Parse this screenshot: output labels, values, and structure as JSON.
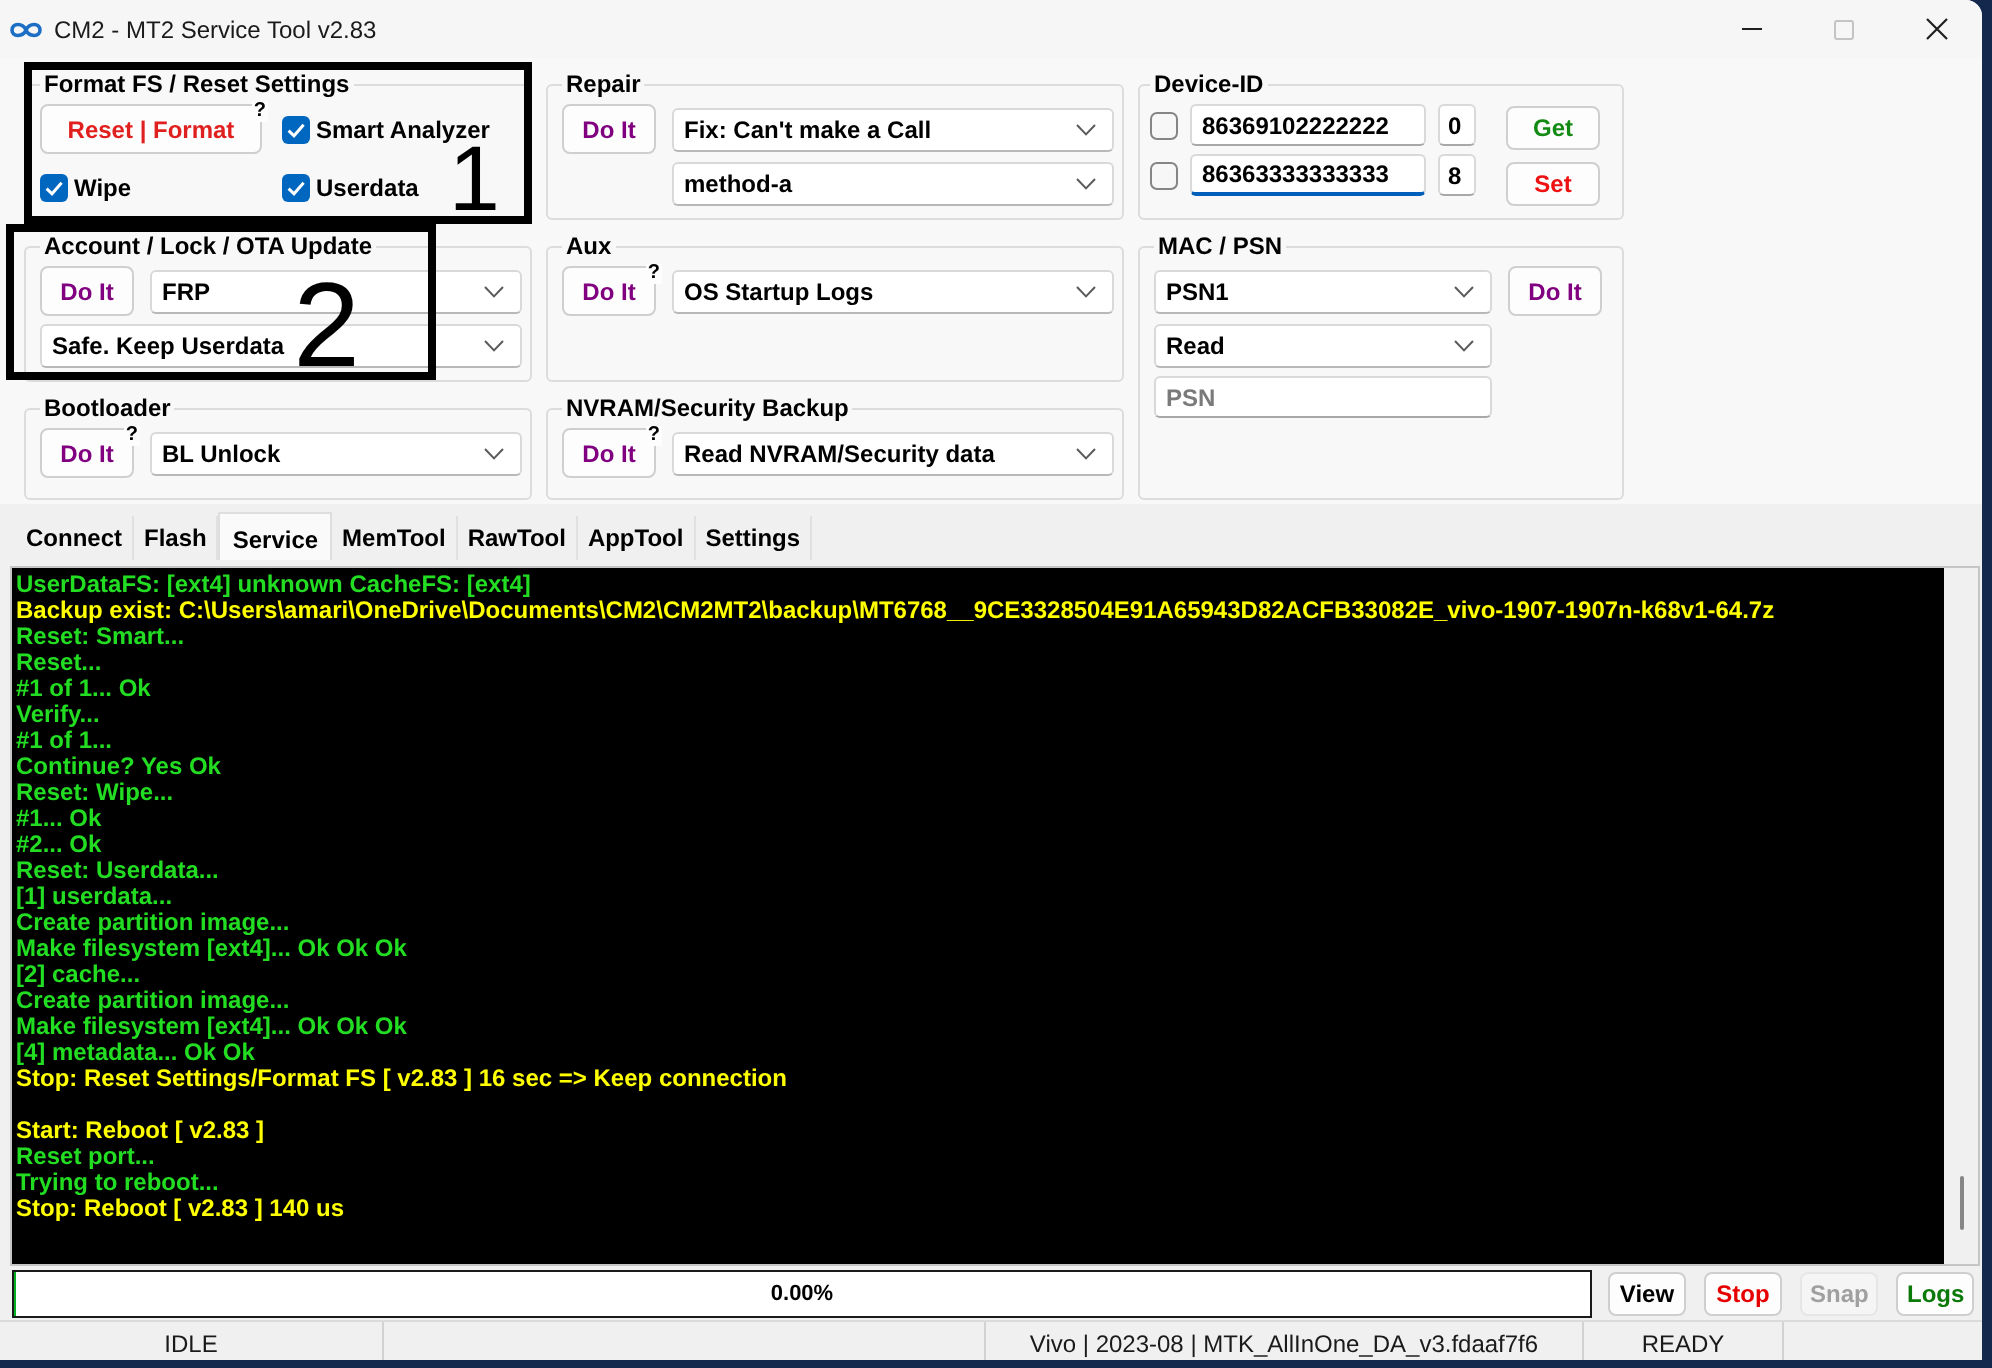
{
  "window": {
    "title": "CM2 - MT2 Service Tool v2.83",
    "controls": [
      {
        "kind": "minimize",
        "disabled": false
      },
      {
        "kind": "maximize",
        "disabled": true
      },
      {
        "kind": "close",
        "disabled": false
      }
    ]
  },
  "groups": [
    {
      "kind": "reset",
      "title": "Format FS / Reset Settings",
      "button": {
        "label": "Reset | Format",
        "help": "?"
      },
      "checkboxes": [
        {
          "label": "Smart Analyzer",
          "checked": true
        },
        {
          "label": "Wipe",
          "checked": true
        },
        {
          "label": "Userdata",
          "checked": true
        }
      ],
      "annotation": {
        "label": "1"
      }
    },
    {
      "kind": "action",
      "title": "Repair",
      "button": {
        "label": "Do It"
      },
      "selects": [
        "Fix: Can't make a Call",
        "method-a"
      ]
    },
    {
      "kind": "device_id",
      "title": "Device-ID",
      "ids": [
        {
          "checked": false,
          "value": "86369102222222",
          "slot": "0",
          "focused": false
        },
        {
          "checked": false,
          "value": "86363333333333",
          "slot": "8",
          "focused": true
        }
      ],
      "buttons": [
        {
          "label": "Get",
          "color": "#138a13"
        },
        {
          "label": "Set",
          "color": "#ee1111"
        }
      ]
    },
    {
      "kind": "action",
      "title": "Account / Lock / OTA Update",
      "button": {
        "label": "Do It"
      },
      "selects": [
        "FRP"
      ],
      "options": [
        "Safe. Keep Userdata"
      ],
      "annotation": {
        "label": "2"
      }
    },
    {
      "kind": "action",
      "title": "Aux",
      "button": {
        "label": "Do It",
        "help": "?"
      },
      "selects": [
        "OS Startup Logs"
      ]
    },
    {
      "kind": "mac",
      "title": "MAC / PSN",
      "selects": [
        "PSN1",
        "Read"
      ],
      "button": {
        "label": "Do It"
      },
      "field": {
        "placeholder": "PSN"
      }
    },
    {
      "kind": "action",
      "title": "Bootloader",
      "button": {
        "label": "Do It",
        "help": "?"
      },
      "selects": [
        "BL Unlock"
      ]
    },
    {
      "kind": "action",
      "title": "NVRAM/Security Backup",
      "button": {
        "label": "Do It",
        "help": "?"
      },
      "selects": [
        "Read NVRAM/Security data"
      ]
    }
  ],
  "tabs": [
    {
      "label": "Connect",
      "selected": false
    },
    {
      "label": "Flash",
      "selected": false
    },
    {
      "label": "Service",
      "selected": true
    },
    {
      "label": "MemTool",
      "selected": false
    },
    {
      "label": "RawTool",
      "selected": false
    },
    {
      "label": "AppTool",
      "selected": false
    },
    {
      "label": "Settings",
      "selected": false
    }
  ],
  "log": [
    {
      "text": "UserDataFS: [ext4] unknown CacheFS: [ext4]",
      "color": "#22dd22"
    },
    {
      "text": "Backup exist: C:\\Users\\amari\\OneDrive\\Documents\\CM2\\CM2MT2\\backup\\MT6768__9CE3328504E91A65943D82ACFB33082E_vivo-1907-1907n-k68v1-64.7z",
      "color": "#ffff00"
    },
    {
      "text": "Reset: Smart...",
      "color": "#22dd22"
    },
    {
      "text": "Reset...",
      "color": "#22dd22"
    },
    {
      "text": "#1 of 1... Ok",
      "color": "#22dd22"
    },
    {
      "text": "Verify...",
      "color": "#22dd22"
    },
    {
      "text": "#1 of 1...",
      "color": "#22dd22"
    },
    {
      "text": "Continue? Yes Ok",
      "color": "#22dd22"
    },
    {
      "text": "Reset: Wipe...",
      "color": "#22dd22"
    },
    {
      "text": "#1... Ok",
      "color": "#22dd22"
    },
    {
      "text": "#2... Ok",
      "color": "#22dd22"
    },
    {
      "text": "Reset: Userdata...",
      "color": "#22dd22"
    },
    {
      "text": "[1] userdata...",
      "color": "#22dd22"
    },
    {
      "text": "Create partition image...",
      "color": "#22dd22"
    },
    {
      "text": "Make filesystem [ext4]... Ok Ok Ok",
      "color": "#22dd22"
    },
    {
      "text": "[2] cache...",
      "color": "#22dd22"
    },
    {
      "text": "Create partition image...",
      "color": "#22dd22"
    },
    {
      "text": "Make filesystem [ext4]... Ok Ok Ok",
      "color": "#22dd22"
    },
    {
      "text": "[4] metadata... Ok Ok",
      "color": "#22dd22"
    },
    {
      "text": "Stop: Reset Settings/Format FS [ v2.83 ] 16 sec => Keep connection",
      "color": "#ffff00"
    },
    {
      "text": "Start: Reboot [ v2.83 ]",
      "color": "#ffff00",
      "gap_before": true
    },
    {
      "text": "Reset port...",
      "color": "#22dd22"
    },
    {
      "text": "Trying to reboot...",
      "color": "#22dd22"
    },
    {
      "text": "Stop: Reboot [ v2.83 ] 140 us",
      "color": "#ffff00"
    }
  ],
  "progress": {
    "level": 0,
    "text": "0.00%"
  },
  "actions": [
    {
      "label": "View",
      "color": "#000000",
      "disabled": false
    },
    {
      "label": "Stop",
      "color": "#e60000",
      "disabled": false
    },
    {
      "label": "Snap",
      "disabled": true
    },
    {
      "label": "Logs",
      "color": "#0b7a0b",
      "disabled": false
    }
  ],
  "status_bar": [
    "IDLE",
    "Vivo | 2023-08 | MTK_AllInOne_DA_v3.fdaaf7f6",
    "READY"
  ]
}
